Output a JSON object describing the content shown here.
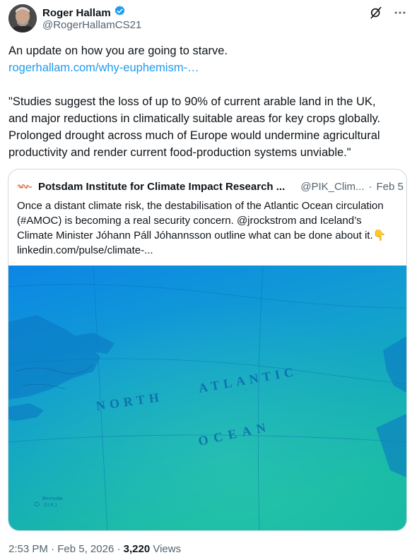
{
  "author": {
    "name": "Roger Hallam",
    "handle": "@RogerHallamCS21",
    "verified": true
  },
  "icons": [
    "verified-badge-icon",
    "grok-icon",
    "more-icon",
    "pik-logo-icon"
  ],
  "tweet": {
    "line1": "An update on how you are going to starve.",
    "link": "rogerhallam.com/why-euphemism-…",
    "quote_line1": "\"Studies suggest the loss of up to 90% of current arable land in the UK,",
    "quote_line2": "and major reductions in climatically suitable areas for key crops globally.",
    "quote_line3": "Prolonged drought across much of Europe would undermine agricultural",
    "quote_line4": "productivity and render current food-production systems unviable.\""
  },
  "quoted": {
    "name": "Potsdam Institute for Climate Impact Research ...",
    "handle": "@PIK_Clim...",
    "separator": "·",
    "date": "Feb 5",
    "line1": "Once a distant climate risk, the destabilisation of the Atlantic Ocean circulation",
    "line2": "(#AMOC) is becoming a real security concern. @jrockstrom and Iceland’s",
    "line3": "Climate Minister Jóhann Páll Jóhannsson outline what can be done about it.",
    "emoji": "👇",
    "link": "linkedin.com/pulse/climate-...",
    "map_labels": {
      "north": "NORTH",
      "atlantic": "ATLANTIC",
      "ocean": "OCEAN",
      "bermuda": "Bermuda",
      "bermuda_sub": "(U.K.)"
    }
  },
  "footer": {
    "time": "2:53 PM",
    "separator": "·",
    "date": "Feb 5, 2026",
    "separator2": "·",
    "views_count": "3,220",
    "views_label": "Views"
  },
  "colors": {
    "link": "#1d9bf0",
    "verified": "#1d9bf0",
    "secondary_text": "#536471",
    "border": "#cfd9de"
  }
}
